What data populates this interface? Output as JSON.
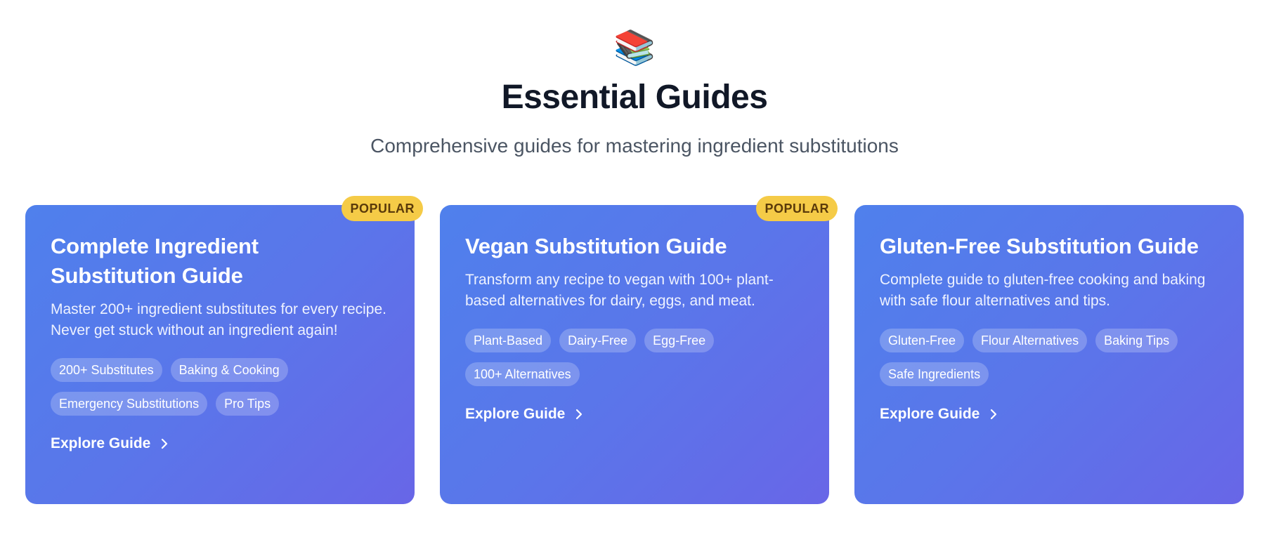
{
  "header": {
    "icon": "📚",
    "icon_name": "books-icon",
    "title": "Essential Guides",
    "subtitle": "Comprehensive guides for mastering ingredient substitutions"
  },
  "cards": [
    {
      "badge": "POPULAR",
      "title": "Complete Ingredient Substitution Guide",
      "description": "Master 200+ ingredient substitutes for every recipe. Never get stuck without an ingredient again!",
      "tags": [
        "200+ Substitutes",
        "Baking & Cooking",
        "Emergency Substitutions",
        "Pro Tips"
      ],
      "cta": "Explore Guide"
    },
    {
      "badge": "POPULAR",
      "title": "Vegan Substitution Guide",
      "description": "Transform any recipe to vegan with 100+ plant-based alternatives for dairy, eggs, and meat.",
      "tags": [
        "Plant-Based",
        "Dairy-Free",
        "Egg-Free",
        "100+ Alternatives"
      ],
      "cta": "Explore Guide"
    },
    {
      "title": "Gluten-Free Substitution Guide",
      "description": "Complete guide to gluten-free cooking and baking with safe flour alternatives and tips.",
      "tags": [
        "Gluten-Free",
        "Flour Alternatives",
        "Baking Tips",
        "Safe Ingredients"
      ],
      "cta": "Explore Guide"
    }
  ],
  "colors": {
    "card_gradient_start": "#4f80ec",
    "card_gradient_end": "#6866e7",
    "badge_bg": "#f5cb47",
    "title_text": "#111827",
    "subtitle_text": "#4b5563"
  }
}
